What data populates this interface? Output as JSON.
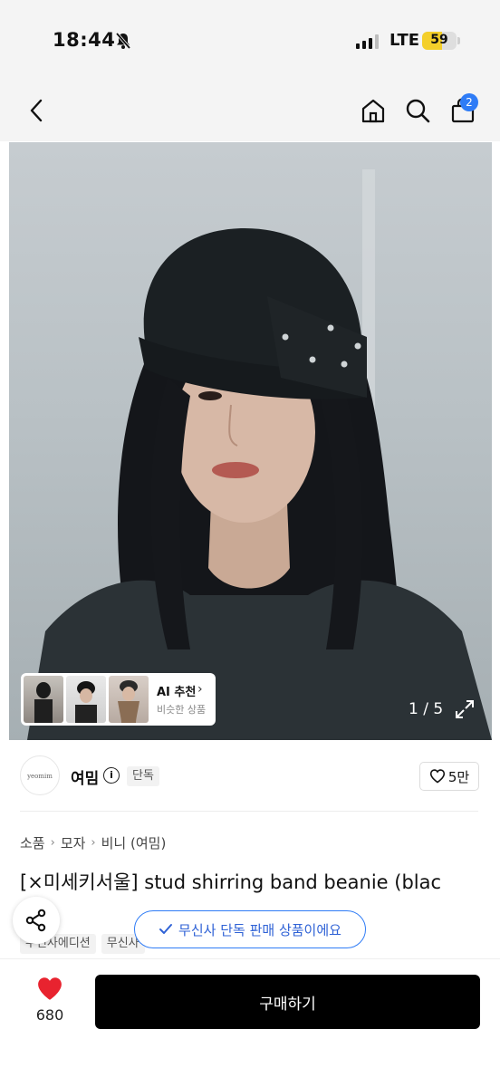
{
  "status_bar": {
    "time": "18:44",
    "network": "LTE",
    "battery": "59",
    "battery_level_percent": 59,
    "icons": [
      "bell-slash-icon",
      "signal-icon",
      "battery-icon"
    ]
  },
  "nav": {
    "icons": [
      "back-icon",
      "home-icon",
      "search-icon",
      "bag-icon"
    ],
    "cart_badge": "2"
  },
  "gallery": {
    "counter": "1 / 5",
    "ai_card": {
      "title": "AI 추천",
      "subtitle": "비슷한 상품"
    }
  },
  "brand": {
    "logo_text": "yeomim",
    "name": "여밈",
    "exclusive_tag": "단독",
    "likes": "5만"
  },
  "breadcrumb": [
    "소품",
    "모자",
    "비니 (여밈)"
  ],
  "product": {
    "title": "[×미세키서울] stud shirring band beanie (blac",
    "tags": [
      "무신사에디션",
      "무신사"
    ]
  },
  "toast": {
    "text": "무신사 단독 판매 상품이에요"
  },
  "bottom_bar": {
    "like_count": "680",
    "buy_label": "구매하기"
  },
  "colors": {
    "accent_blue": "#2f7cf6",
    "heart_red": "#e8232f",
    "buy_button": "#000000",
    "battery_yellow": "#f4cf2a"
  }
}
